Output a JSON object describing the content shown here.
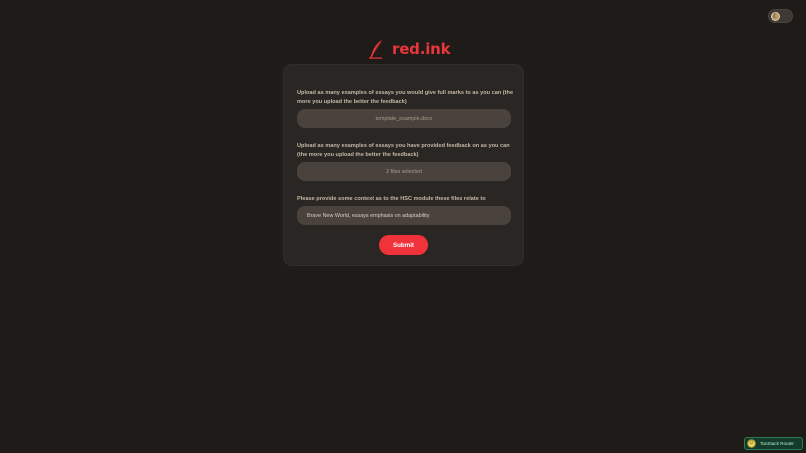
{
  "brand": {
    "name": "red.ink",
    "color": "#e8363c"
  },
  "theme_toggle": {
    "icon": "moon-icon"
  },
  "form": {
    "full_marks": {
      "label": "Upload as many examples of essays you would give full marks to as you can (the more you upload the better the feedback)",
      "value": "template_example.docx"
    },
    "feedback": {
      "label": "Upload as many examples of essays you have provided feedback on as you can (the more you upload the better the feedback)",
      "value": "2 files selected"
    },
    "context": {
      "label": "Please provide some context as to the HSC module these files relate to",
      "value": "Brave New World, essays emphasis on adaptability"
    },
    "submit_label": "Submit"
  },
  "devtools": {
    "label": "TanStack Router",
    "icon": "tanstack-logo-icon"
  },
  "colors": {
    "background": "#1f1b19",
    "card": "#2a2623",
    "field": "#4a433d",
    "accent": "#f0333b"
  }
}
